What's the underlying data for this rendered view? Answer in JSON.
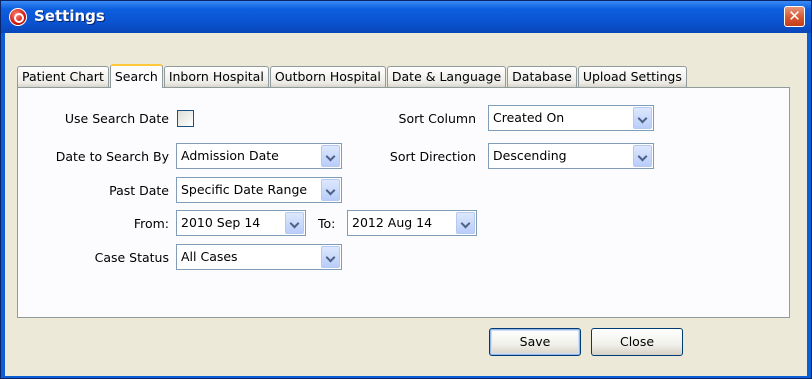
{
  "window": {
    "title": "Settings",
    "close_glyph": "✕"
  },
  "tabs": [
    {
      "label": "Patient Chart"
    },
    {
      "label": "Search"
    },
    {
      "label": "Inborn Hospital"
    },
    {
      "label": "Outborn Hospital"
    },
    {
      "label": "Date & Language"
    },
    {
      "label": "Database"
    },
    {
      "label": "Upload Settings"
    }
  ],
  "active_tab": "Search",
  "form": {
    "use_search_date": {
      "label": "Use Search Date",
      "checked": false
    },
    "date_to_search_by": {
      "label": "Date to Search By",
      "value": "Admission Date"
    },
    "past_date": {
      "label": "Past Date",
      "value": "Specific Date Range"
    },
    "from": {
      "label": "From:",
      "value": "2010 Sep 14"
    },
    "to": {
      "label": "To:",
      "value": "2012 Aug 14"
    },
    "case_status": {
      "label": "Case Status",
      "value": "All Cases"
    },
    "sort_column": {
      "label": "Sort Column",
      "value": "Created On"
    },
    "sort_direction": {
      "label": "Sort Direction",
      "value": "Descending"
    }
  },
  "buttons": {
    "save": "Save",
    "close": "Close"
  },
  "icons": {
    "app": "app-logo-icon",
    "dropdown": "chevron-down-icon"
  },
  "colors": {
    "titlebar": "#0a52cf",
    "dialog_bg": "#ece9d8",
    "active_tab_accent": "#ffc83c"
  }
}
